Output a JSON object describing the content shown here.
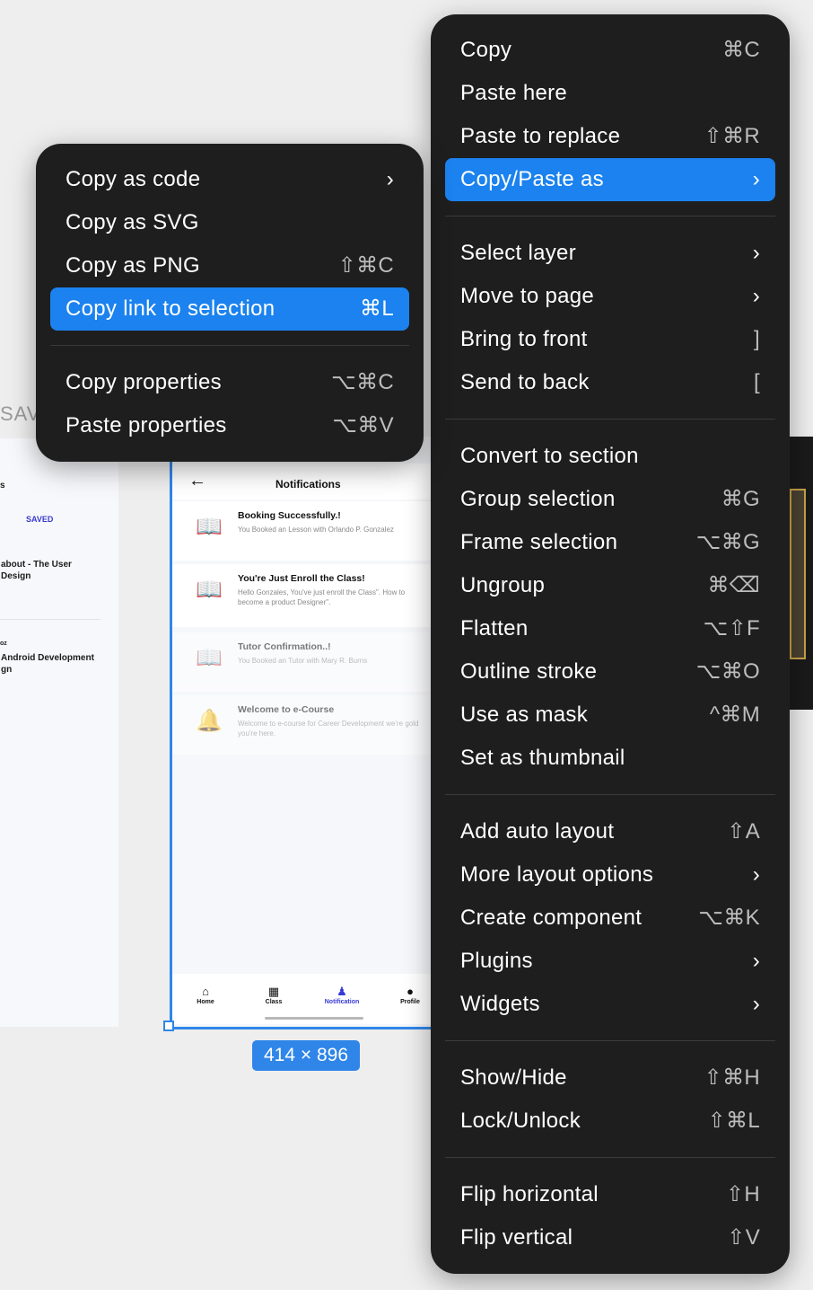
{
  "canvas": {
    "left_frame_label": "SAV",
    "left_frame": {
      "frag1": "s",
      "saved": "SAVED",
      "frag2": "about - The User\nDesign",
      "frag3": "oz",
      "frag4": "Android Development\ngn"
    },
    "phone": {
      "title": "Notifications",
      "back_icon": "arrow-left-icon",
      "notifications": [
        {
          "title": "Booking Successfully.!",
          "desc": "You Booked an Lesson with Orlando P. Gonzalez",
          "icon": "📖"
        },
        {
          "title": "You're Just Enroll the Class!",
          "desc": "Hello Gonzales, You've just enroll the Class\". How to become a product Designer\".",
          "icon": "📖"
        },
        {
          "title": "Tutor Confirmation..!",
          "desc": "You Booked an Tutor with Mary R. Burns",
          "icon": "📖"
        },
        {
          "title": "Welcome to e-Course",
          "desc": "Welcome to e-course for Career Development we're gold you're here.",
          "icon": "🔔"
        }
      ],
      "nav": [
        {
          "label": "Home",
          "icon": "⌂"
        },
        {
          "label": "Class",
          "icon": "▦"
        },
        {
          "label": "Notification",
          "icon": "♟"
        },
        {
          "label": "Profile",
          "icon": "●"
        }
      ]
    },
    "size_badge": "414 × 896"
  },
  "right_menu": {
    "items": [
      {
        "label": "Copy",
        "shortcut": "⌘C"
      },
      {
        "label": "Paste here",
        "shortcut": ""
      },
      {
        "label": "Paste to replace",
        "shortcut": "⇧⌘R"
      },
      {
        "label": "Copy/Paste as",
        "shortcut": "›"
      },
      {
        "label": "Select layer",
        "shortcut": "›"
      },
      {
        "label": "Move to page",
        "shortcut": "›"
      },
      {
        "label": "Bring to front",
        "shortcut": "]"
      },
      {
        "label": "Send to back",
        "shortcut": "["
      },
      {
        "label": "Convert to section",
        "shortcut": ""
      },
      {
        "label": "Group selection",
        "shortcut": "⌘G"
      },
      {
        "label": "Frame selection",
        "shortcut": "⌥⌘G"
      },
      {
        "label": "Ungroup",
        "shortcut": "⌘⌫"
      },
      {
        "label": "Flatten",
        "shortcut": "⌥⇧F"
      },
      {
        "label": "Outline stroke",
        "shortcut": "⌥⌘O"
      },
      {
        "label": "Use as mask",
        "shortcut": "^⌘M"
      },
      {
        "label": "Set as thumbnail",
        "shortcut": ""
      },
      {
        "label": "Add auto layout",
        "shortcut": "⇧A"
      },
      {
        "label": "More layout options",
        "shortcut": "›"
      },
      {
        "label": "Create component",
        "shortcut": "⌥⌘K"
      },
      {
        "label": "Plugins",
        "shortcut": "›"
      },
      {
        "label": "Widgets",
        "shortcut": "›"
      },
      {
        "label": "Show/Hide",
        "shortcut": "⇧⌘H"
      },
      {
        "label": "Lock/Unlock",
        "shortcut": "⇧⌘L"
      },
      {
        "label": "Flip horizontal",
        "shortcut": "⇧H"
      },
      {
        "label": "Flip vertical",
        "shortcut": "⇧V"
      }
    ]
  },
  "left_menu": {
    "items": [
      {
        "label": "Copy as code",
        "shortcut": "›"
      },
      {
        "label": "Copy as SVG",
        "shortcut": ""
      },
      {
        "label": "Copy as PNG",
        "shortcut": "⇧⌘C"
      },
      {
        "label": "Copy link to selection",
        "shortcut": "⌘L"
      },
      {
        "label": "Copy properties",
        "shortcut": "⌥⌘C"
      },
      {
        "label": "Paste properties",
        "shortcut": "⌥⌘V"
      }
    ]
  },
  "colors": {
    "menu_bg": "#1e1e1e",
    "highlight": "#1b82ef",
    "selection": "#2f86e8"
  }
}
